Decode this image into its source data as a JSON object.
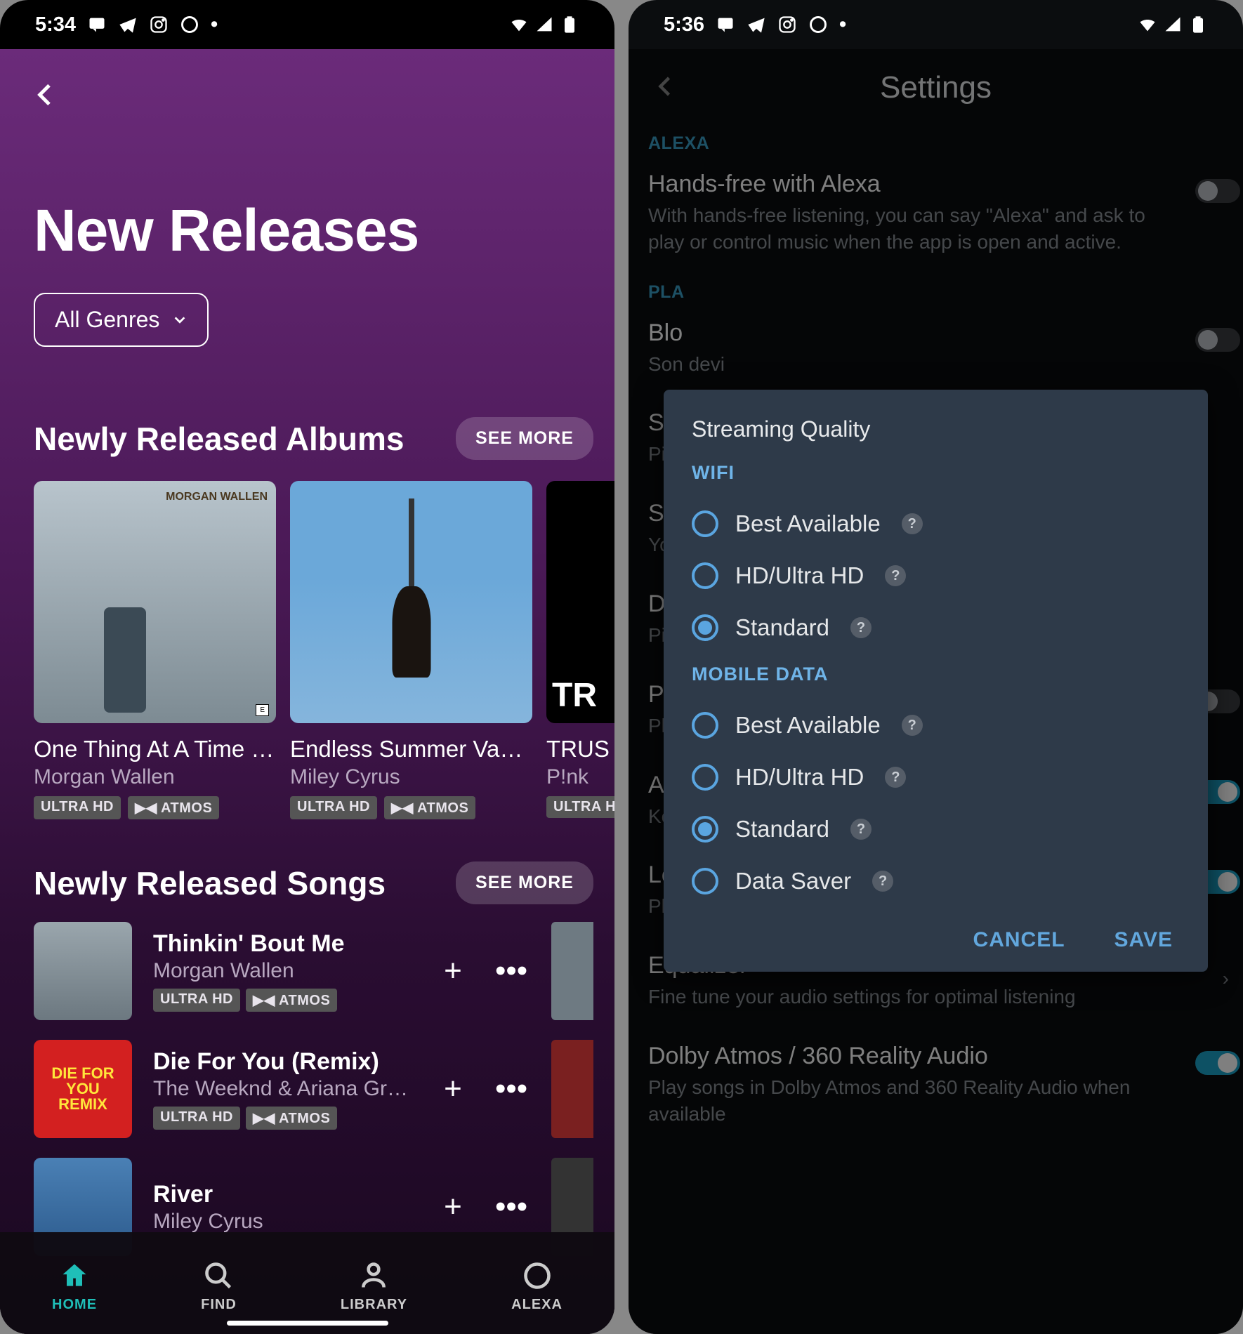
{
  "statusbar": {
    "left_time": "5:34",
    "right_time": "5:36",
    "dot": "•"
  },
  "nr": {
    "title": "New Releases",
    "genre_label": "All Genres",
    "albums_section": "Newly Released Albums",
    "songs_section": "Newly Released Songs",
    "see_more": "SEE MORE",
    "badge_ultra": "ULTRA HD",
    "badge_atmos": "▶◀ ATMOS",
    "albums": [
      {
        "title": "One Thing At A Time …",
        "artist": "Morgan Wallen"
      },
      {
        "title": "Endless Summer Vaca…",
        "artist": "Miley Cyrus"
      },
      {
        "title": "TRUS",
        "artist": "P!nk"
      }
    ],
    "songs": [
      {
        "title": "Thinkin' Bout Me",
        "artist": "Morgan Wallen"
      },
      {
        "title": "Die For You (Remix)",
        "artist": "The Weeknd & Ariana Gran…"
      },
      {
        "title": "River",
        "artist": "Miley Cyrus"
      }
    ]
  },
  "nav": {
    "home": "HOME",
    "find": "FIND",
    "library": "LIBRARY",
    "alexa": "ALEXA"
  },
  "settings": {
    "title": "Settings",
    "alexa_section": "ALEXA",
    "alexa_item": "Hands-free with Alexa",
    "alexa_desc": "With hands-free listening, you can say \"Alexa\" and ask to play or control music when the app is open and active.",
    "playback_section": "PLA",
    "blo_title": "Blo",
    "blo_desc": "Son  devi",
    "stre1_t": "Stre",
    "stre1_d": "Pick                                                               ata",
    "stre2_t": "Stre",
    "stre2_d": "You",
    "dow_t": "Dow",
    "dow_d": "Pick                                                               ose dow",
    "play_t": "Play",
    "play_d": "Play qual",
    "aut_t": "Aut",
    "aut_d": "Keep",
    "loud_t": "Loudness",
    "loud_d": "Play all songs at the same loudness level",
    "eq_t": "Equalizer",
    "eq_d": "Fine tune your audio settings for optimal listening",
    "dolby_t": "Dolby Atmos / 360 Reality Audio",
    "dolby_d": "Play songs in Dolby Atmos and 360 Reality Audio when available"
  },
  "dialog": {
    "title": "Streaming Quality",
    "wifi": "WIFI",
    "mobile": "MOBILE DATA",
    "opt_best": "Best Available",
    "opt_hd": "HD/Ultra HD",
    "opt_std": "Standard",
    "opt_saver": "Data Saver",
    "cancel": "CANCEL",
    "save": "SAVE"
  }
}
